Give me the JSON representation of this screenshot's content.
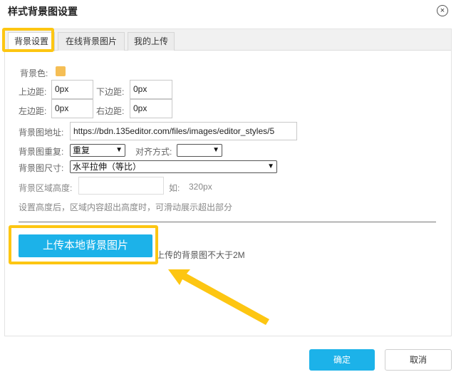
{
  "dialog": {
    "title": "样式背景图设置",
    "close_icon": "×"
  },
  "tabs": [
    {
      "label": "背景设置",
      "active": true
    },
    {
      "label": "在线背景图片",
      "active": false
    },
    {
      "label": "我的上传",
      "active": false
    }
  ],
  "form": {
    "bg_color_label": "背景色:",
    "bg_color_value": "#f5be55",
    "margin_top_label": "上边距:",
    "margin_top_value": "0px",
    "margin_bottom_label": "下边距:",
    "margin_bottom_value": "0px",
    "margin_left_label": "左边距:",
    "margin_left_value": "0px",
    "margin_right_label": "右边距:",
    "margin_right_value": "0px",
    "image_url_label": "背景图地址:",
    "image_url_value": "https://bdn.135editor.com/files/images/editor_styles/5",
    "repeat_label": "背景图重复:",
    "repeat_value": "重复",
    "align_label": "对齐方式:",
    "align_value": "",
    "size_label": "背景图尺寸:",
    "size_value": "水平拉伸（等比）",
    "height_label": "背景区域高度:",
    "height_value": "",
    "height_example_label": "如:",
    "height_example_value": "320px",
    "hint": "设置高度后，区域内容超出高度时，可滑动展示超出部分"
  },
  "upload": {
    "button_label": "上传本地背景图片",
    "note": "上传的背景图不大于2M"
  },
  "footer": {
    "ok_label": "确定",
    "cancel_label": "取消"
  },
  "colors": {
    "accent": "#1cb2e9",
    "highlight": "#fdc612"
  }
}
